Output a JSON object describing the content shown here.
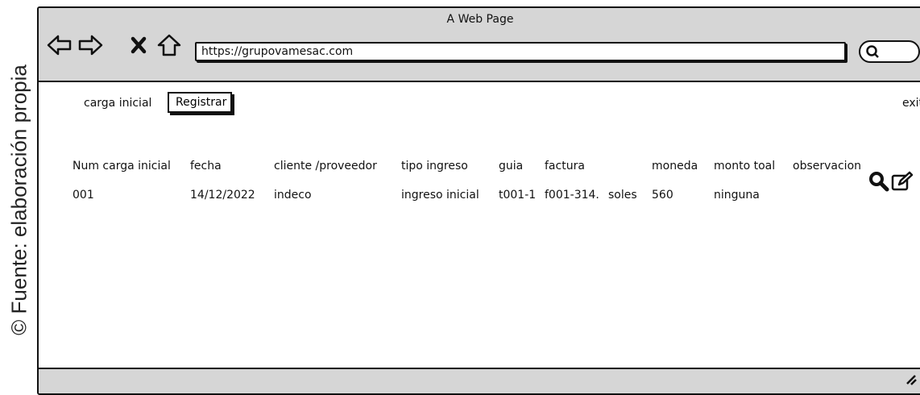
{
  "caption": "© Fuente: elaboración propia",
  "window": {
    "title": "A Web Page",
    "url": "https://grupovamesac.com"
  },
  "toolbar": {
    "icons": [
      "back-arrow-icon",
      "forward-arrow-icon",
      "close-x-icon",
      "home-icon",
      "search-icon"
    ]
  },
  "menu": {
    "carga_inicial": "carga inicial",
    "registrar": "Registrar",
    "exit": "exit"
  },
  "table": {
    "headers": [
      "Num carga inicial",
      "fecha",
      "cliente /proveedor",
      "tipo ingreso",
      "guia",
      "factura",
      "moneda",
      "monto toal",
      "observacion"
    ],
    "rows": [
      [
        "001",
        "14/12/2022",
        "indeco",
        "ingreso inicial",
        "t001-1",
        "f001-314.",
        "soles",
        "560",
        "ninguna"
      ]
    ],
    "row_action_icons": [
      "search-icon",
      "edit-icon"
    ]
  }
}
